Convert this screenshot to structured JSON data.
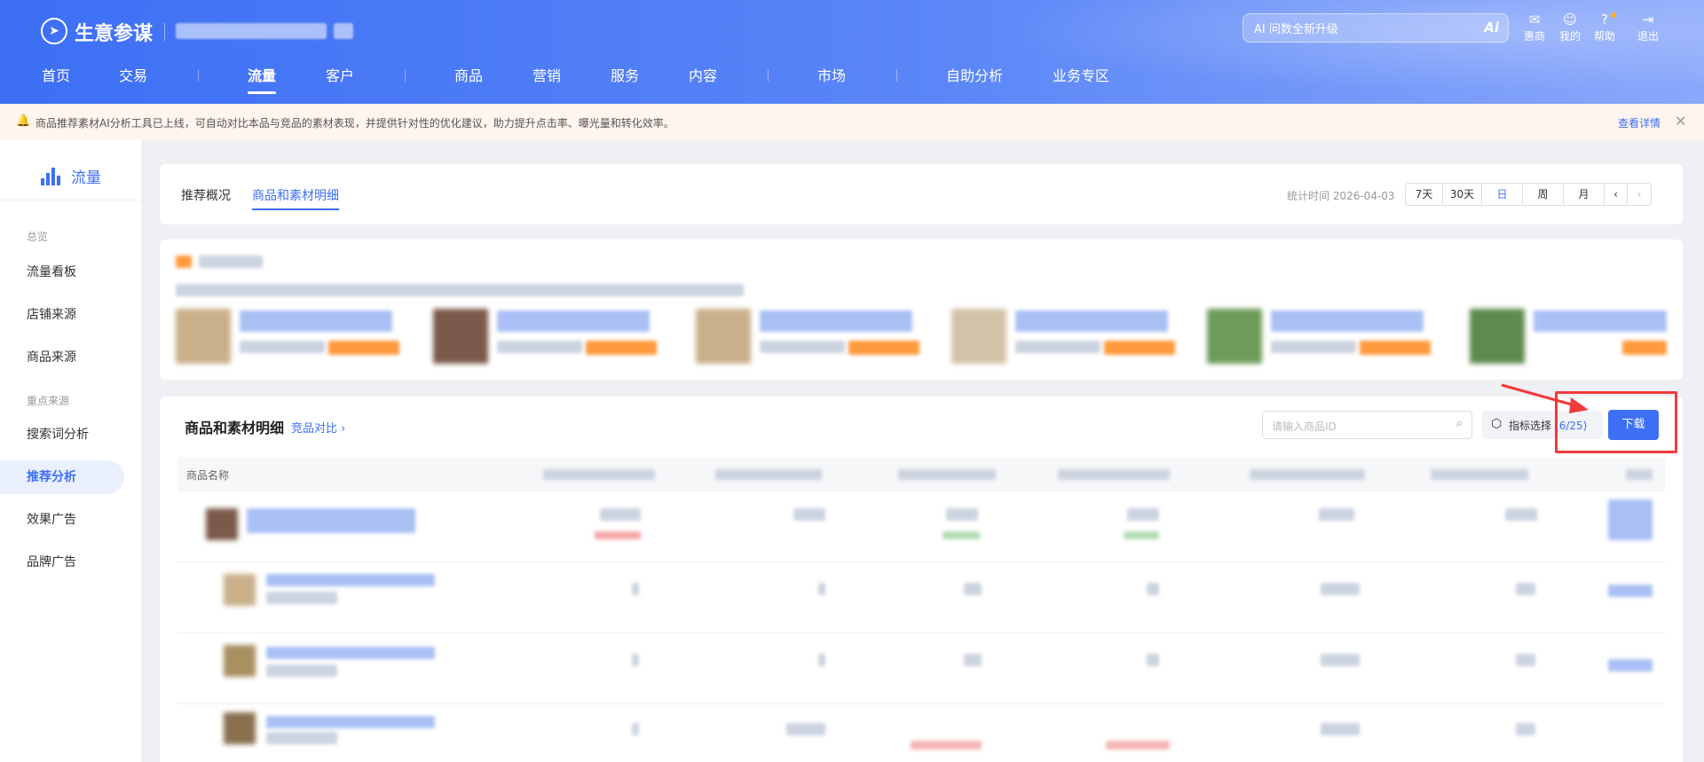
{
  "header": {
    "app_name": "生意参谋",
    "nav": [
      "首页",
      "交易",
      "流量",
      "客户",
      "商品",
      "营销",
      "服务",
      "内容",
      "市场",
      "自助分析",
      "业务专区"
    ],
    "active_nav": "流量",
    "ai_search_placeholder": "AI 问数全新升级",
    "tools": [
      {
        "label": "惠商",
        "icon": "mail-icon"
      },
      {
        "label": "我的",
        "icon": "user-icon"
      },
      {
        "label": "帮助",
        "icon": "help-icon"
      },
      {
        "label": "退出",
        "icon": "logout-icon"
      }
    ]
  },
  "notice": {
    "text": "商品推荐素材AI分析工具已上线，可自动对比本品与竞品的素材表现，并提供针对性的优化建议，助力提升点击率、曝光量和转化效率。",
    "detail_link": "查看详情"
  },
  "sidebar": {
    "title": "流量",
    "groups": [
      {
        "label": "总览",
        "items": [
          "流量看板",
          "店铺来源",
          "商品来源"
        ]
      },
      {
        "label": "重点来源",
        "items": [
          "搜索词分析",
          "推荐分析",
          "效果广告",
          "品牌广告"
        ]
      }
    ],
    "active_item": "推荐分析"
  },
  "tabs": {
    "items": [
      "推荐概况",
      "商品和素材明细"
    ],
    "active": "商品和素材明细",
    "stat_time": "统计时间 2026-04-03",
    "periods": [
      "7天",
      "30天",
      "日",
      "周",
      "月"
    ],
    "active_period": "日"
  },
  "table": {
    "title": "商品和素材明细",
    "compare_link": "竞品对比",
    "search_placeholder": "请输入商品ID",
    "metric_button": "指标选择",
    "metric_count": "(6/25)",
    "download_label": "下载",
    "first_column": "商品名称"
  },
  "colors": {
    "primary": "#3d6ff5",
    "annotation": "#f03b3b",
    "notice_bg": "#fff4ee"
  }
}
